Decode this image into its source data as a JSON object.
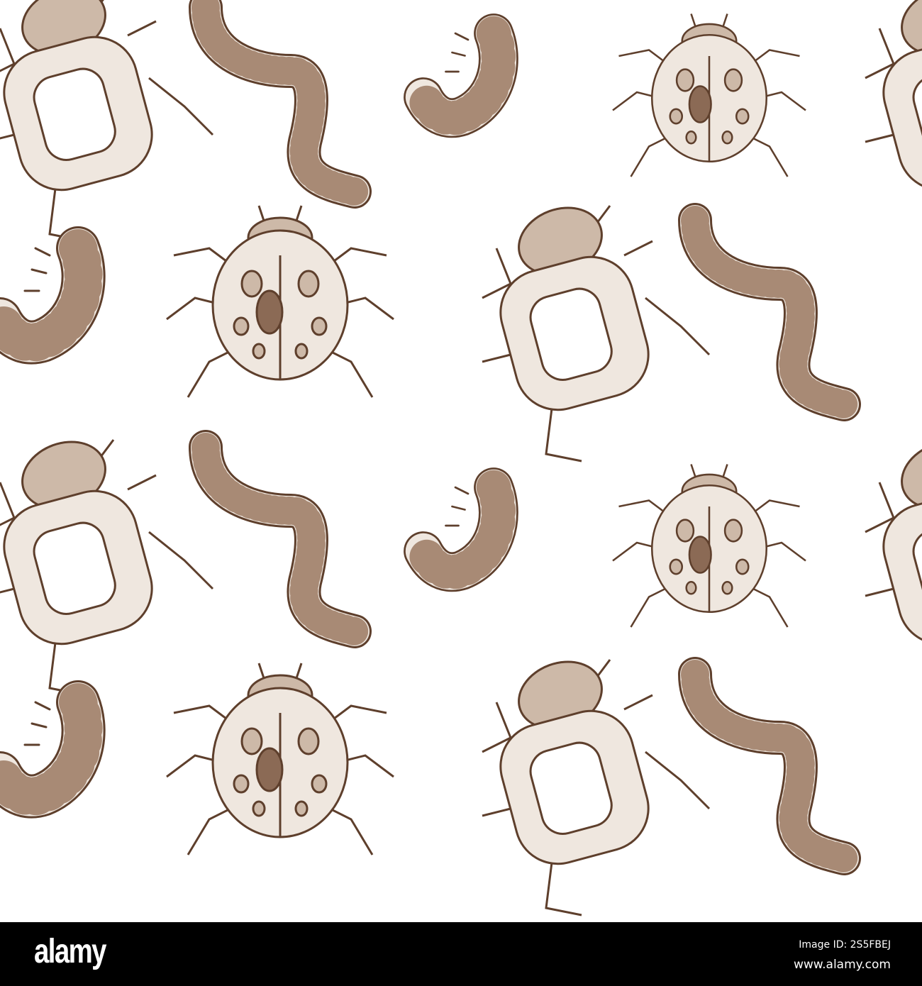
{
  "colors": {
    "ink": "#5e3f2c",
    "fill": "#efe7df",
    "shade": "#cdb9a8",
    "bar": "#000000"
  },
  "watermark": {
    "logo": "alamy",
    "image_id": "Image ID: 2S5FBEJ",
    "url": "www.alamy.com"
  }
}
